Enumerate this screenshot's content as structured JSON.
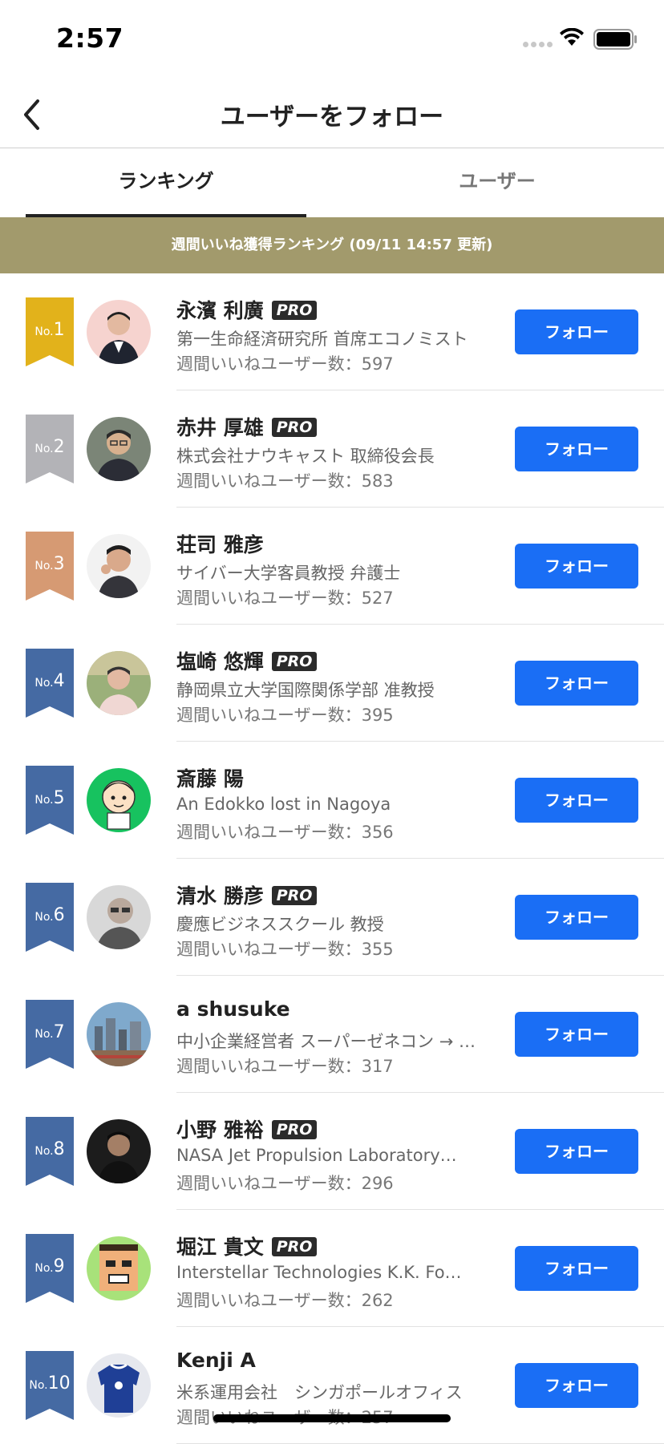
{
  "status_bar": {
    "time": "2:57"
  },
  "nav": {
    "title": "ユーザーをフォロー"
  },
  "tabs": [
    {
      "label": "ランキング",
      "active": true
    },
    {
      "label": "ユーザー",
      "active": false
    }
  ],
  "banner": {
    "text": "週間いいね獲得ランキング (09/11 14:57 更新)"
  },
  "ranking": [
    {
      "rank_prefix": "No.",
      "rank": "1",
      "name": "永濱 利廣",
      "pro": true,
      "pro_label": "PRO",
      "description": "第一生命経済研究所 首席エコノミスト",
      "likes": "週間いいねユーザー数：597",
      "follow_label": "フォロー",
      "ribbon_color": "#e2b21b",
      "avatar_icon": "avatar-photo-man-suit"
    },
    {
      "rank_prefix": "No.",
      "rank": "2",
      "name": "赤井 厚雄",
      "pro": true,
      "pro_label": "PRO",
      "description": "株式会社ナウキャスト 取締役会長",
      "likes": "週間いいねユーザー数：583",
      "follow_label": "フォロー",
      "ribbon_color": "#b3b3b7",
      "avatar_icon": "avatar-photo-man-glasses"
    },
    {
      "rank_prefix": "No.",
      "rank": "3",
      "name": "荘司 雅彦",
      "pro": false,
      "pro_label": "",
      "description": "サイバー大学客員教授 弁護士",
      "likes": "週間いいねユーザー数：527",
      "follow_label": "フォロー",
      "ribbon_color": "#d69a73",
      "avatar_icon": "avatar-photo-man-thinking"
    },
    {
      "rank_prefix": "No.",
      "rank": "4",
      "name": "塩崎 悠輝",
      "pro": true,
      "pro_label": "PRO",
      "description": "静岡県立大学国際関係学部 准教授",
      "likes": "週間いいねユーザー数：395",
      "follow_label": "フォロー",
      "ribbon_color": "#456aa3",
      "avatar_icon": "avatar-photo-man-outdoor"
    },
    {
      "rank_prefix": "No.",
      "rank": "5",
      "name": "斎藤 陽",
      "pro": false,
      "pro_label": "",
      "description": "An Edokko lost in Nagoya",
      "likes": "週間いいねユーザー数：356",
      "follow_label": "フォロー",
      "ribbon_color": "#456aa3",
      "avatar_icon": "avatar-cartoon-green"
    },
    {
      "rank_prefix": "No.",
      "rank": "6",
      "name": "清水 勝彦",
      "pro": true,
      "pro_label": "PRO",
      "description": "慶應ビジネススクール 教授",
      "likes": "週間いいねユーザー数：355",
      "follow_label": "フォロー",
      "ribbon_color": "#456aa3",
      "avatar_icon": "avatar-photo-man-glasses-bw"
    },
    {
      "rank_prefix": "No.",
      "rank": "7",
      "name": "a shusuke",
      "pro": false,
      "pro_label": "",
      "description": "中小企業経営者 スーパーゼネコン → …",
      "likes": "週間いいねユーザー数：317",
      "follow_label": "フォロー",
      "ribbon_color": "#456aa3",
      "avatar_icon": "avatar-photo-city"
    },
    {
      "rank_prefix": "No.",
      "rank": "8",
      "name": "小野 雅裕",
      "pro": true,
      "pro_label": "PRO",
      "description": "NASA Jet Propulsion Laboratory…",
      "likes": "週間いいねユーザー数：296",
      "follow_label": "フォロー",
      "ribbon_color": "#456aa3",
      "avatar_icon": "avatar-photo-man-dark"
    },
    {
      "rank_prefix": "No.",
      "rank": "9",
      "name": "堀江 貴文",
      "pro": true,
      "pro_label": "PRO",
      "description": "Interstellar Technologies K.K. Fo…",
      "likes": "週間いいねユーザー数：262",
      "follow_label": "フォロー",
      "ribbon_color": "#456aa3",
      "avatar_icon": "avatar-pixel-face"
    },
    {
      "rank_prefix": "No.",
      "rank": "10",
      "name": "Kenji A",
      "pro": false,
      "pro_label": "",
      "description": "米系運用会社　シンガポールオフィス",
      "likes": "週間いいねユーザー数：257",
      "follow_label": "フォロー",
      "ribbon_color": "#456aa3",
      "avatar_icon": "avatar-photo-jersey"
    }
  ]
}
